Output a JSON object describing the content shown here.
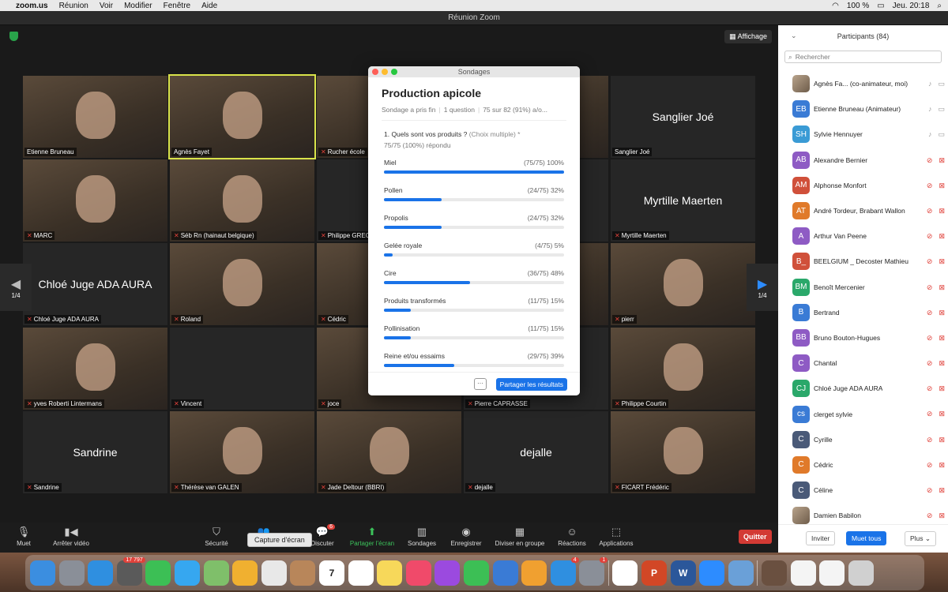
{
  "menubar": {
    "app": "zoom.us",
    "items": [
      "Réunion",
      "Voir",
      "Modifier",
      "Fenêtre",
      "Aide"
    ],
    "battery": "100 %",
    "clock": "Jeu. 20:18"
  },
  "window": {
    "title": "Réunion Zoom"
  },
  "main": {
    "view_button": "Affichage"
  },
  "tiles": [
    {
      "name": "Etienne Bruneau",
      "muted": false,
      "video": true
    },
    {
      "name": "Agnès Fayet",
      "muted": false,
      "video": true,
      "active": true
    },
    {
      "name": "Rucher école",
      "muted": true,
      "video": true
    },
    {
      "name": "",
      "muted": false,
      "video": true
    },
    {
      "name": "Sanglier Joé",
      "big": "Sanglier Joé",
      "muted": false,
      "video": false
    },
    {
      "name": "MARC",
      "muted": true,
      "video": true
    },
    {
      "name": "Séb Rn (hainaut belgique)",
      "muted": true,
      "video": true
    },
    {
      "name": "Philippe GREG",
      "big": "Philip",
      "muted": true,
      "video": false
    },
    {
      "name": "",
      "muted": false,
      "video": false
    },
    {
      "name": "Myrtille Maerten",
      "big": "Myrtille Maerten",
      "muted": true,
      "video": false
    },
    {
      "name": "Chloé Juge ADA AURA",
      "big": "Chloé Juge ADA AURA",
      "muted": true,
      "video": false
    },
    {
      "name": "Roland",
      "muted": true,
      "video": true
    },
    {
      "name": "Cédric",
      "muted": true,
      "video": true
    },
    {
      "name": "",
      "muted": false,
      "video": true
    },
    {
      "name": "pierr",
      "muted": true,
      "video": true
    },
    {
      "name": "yves Roberti Lintermans",
      "muted": true,
      "video": true
    },
    {
      "name": "Vincent",
      "muted": true,
      "video": false
    },
    {
      "name": "joce",
      "muted": true,
      "video": true
    },
    {
      "name": "Pierre CAPRASSE",
      "muted": true,
      "video": false
    },
    {
      "name": "Philippe Courtin",
      "muted": true,
      "video": true
    },
    {
      "name": "Sandrine",
      "big": "Sandrine",
      "muted": true,
      "video": false
    },
    {
      "name": "Thérèse van GALEN",
      "muted": true,
      "video": true
    },
    {
      "name": "Jade Deltour (BBRI)",
      "muted": true,
      "video": true
    },
    {
      "name": "dejalle",
      "big": "dejalle",
      "muted": true,
      "video": false
    },
    {
      "name": "FICART Frédéric",
      "muted": true,
      "video": true
    }
  ],
  "pager": {
    "left": "1/4",
    "right": "1/4"
  },
  "poll": {
    "window_title": "Sondages",
    "title": "Production apicole",
    "status": "Sondage a pris fin",
    "questions": "1 question",
    "participation": "75 sur 82 (91%) a/o...",
    "question": "1. Quels sont vos produits ?",
    "question_hint": "(Choix multiple) *",
    "answered": "75/75 (100%) répondu",
    "options": [
      {
        "label": "Miel",
        "count": "(75/75) 100%",
        "fraction": 1.0
      },
      {
        "label": "Pollen",
        "count": "(24/75) 32%",
        "fraction": 0.32
      },
      {
        "label": "Propolis",
        "count": "(24/75) 32%",
        "fraction": 0.32
      },
      {
        "label": "Gelée royale",
        "count": "(4/75) 5%",
        "fraction": 0.05
      },
      {
        "label": "Cire",
        "count": "(36/75) 48%",
        "fraction": 0.48
      },
      {
        "label": "Produits transformés",
        "count": "(11/75) 15%",
        "fraction": 0.15
      },
      {
        "label": "Pollinisation",
        "count": "(11/75) 15%",
        "fraction": 0.15
      },
      {
        "label": "Reine et/ou essaims",
        "count": "(29/75) 39%",
        "fraction": 0.39
      }
    ],
    "more": "···",
    "share_button": "Partager les résultats"
  },
  "participants": {
    "header": "Participants (84)",
    "search_placeholder": "Rechercher",
    "list": [
      {
        "initials": "",
        "name": "Agnès Fa... (co-animateur, moi)",
        "color": "#8a7a6a",
        "photo": true,
        "mic_off": false,
        "vid_off": false
      },
      {
        "initials": "EB",
        "name": "Etienne Bruneau (Animateur)",
        "color": "#3a7bd5",
        "mic_off": false,
        "vid_off": false
      },
      {
        "initials": "SH",
        "name": "Sylvie Hennuyer",
        "color": "#3a9bd5",
        "mic_off": false,
        "vid_off": false
      },
      {
        "initials": "AB",
        "name": "Alexandre Bernier",
        "color": "#8e5bc4",
        "mic_off": true,
        "vid_off": true
      },
      {
        "initials": "AM",
        "name": "Alphonse Monfort",
        "color": "#d0503a",
        "mic_off": true,
        "vid_off": true
      },
      {
        "initials": "AT",
        "name": "André Tordeur, Brabant Wallon",
        "color": "#e07a2a",
        "mic_off": true,
        "vid_off": true
      },
      {
        "initials": "A",
        "name": "Arthur Van Peene",
        "color": "#8e5bc4",
        "mic_off": true,
        "vid_off": true
      },
      {
        "initials": "B_",
        "name": "BEELGIUM _ Decoster Mathieu",
        "color": "#d0503a",
        "mic_off": true,
        "vid_off": true
      },
      {
        "initials": "BM",
        "name": "Benoît Mercenier",
        "color": "#2aa86a",
        "mic_off": true,
        "vid_off": true
      },
      {
        "initials": "B",
        "name": "Bertrand",
        "color": "#3a7bd5",
        "mic_off": true,
        "vid_off": true
      },
      {
        "initials": "BB",
        "name": "Bruno Bouton-Hugues",
        "color": "#8e5bc4",
        "mic_off": true,
        "vid_off": true
      },
      {
        "initials": "C",
        "name": "Chantal",
        "color": "#8e5bc4",
        "mic_off": true,
        "vid_off": true
      },
      {
        "initials": "CJ",
        "name": "Chloé Juge ADA AURA",
        "color": "#2aa86a",
        "mic_off": true,
        "vid_off": true
      },
      {
        "initials": "cs",
        "name": "clerget sylvie",
        "color": "#3a7bd5",
        "mic_off": true,
        "vid_off": true
      },
      {
        "initials": "C",
        "name": "Cyrille",
        "color": "#4a5a78",
        "mic_off": true,
        "vid_off": true
      },
      {
        "initials": "C",
        "name": "Cédric",
        "color": "#e07a2a",
        "mic_off": true,
        "vid_off": true
      },
      {
        "initials": "C",
        "name": "Céline",
        "color": "#4a5a78",
        "mic_off": true,
        "vid_off": true
      },
      {
        "initials": "",
        "name": "Damien Babilon",
        "color": "#6a5a4a",
        "photo": true,
        "mic_off": true,
        "vid_off": true
      }
    ],
    "invite_button": "Inviter",
    "mute_all_button": "Muet tous",
    "more_button": "Plus"
  },
  "toolbar": {
    "mute": "Muet",
    "stop_video": "Arrêter vidéo",
    "security": "Sécurité",
    "participants_count": "84",
    "chat": "Discuter",
    "chat_badge": "6",
    "share_screen": "Partager l'écran",
    "polls": "Sondages",
    "record": "Enregistrer",
    "breakout": "Diviser en groupe",
    "reactions": "Réactions",
    "apps": "Applications",
    "quit": "Quitter",
    "tooltip": "Capture d'écran"
  },
  "dock": {
    "icons": [
      {
        "name": "finder-icon",
        "color": "#3b8ee0"
      },
      {
        "name": "launchpad-icon",
        "color": "#8a8f98"
      },
      {
        "name": "safari-icon",
        "color": "#2f8fe0"
      },
      {
        "name": "photos-badge-icon",
        "color": "#5a5a5a",
        "badge": "17 797"
      },
      {
        "name": "facetime-icon",
        "color": "#3cbf55"
      },
      {
        "name": "messages-icon",
        "color": "#36a7f0"
      },
      {
        "name": "maps-icon",
        "color": "#7fbf6a"
      },
      {
        "name": "photos-icon",
        "color": "#f0b030"
      },
      {
        "name": "screenshot-icon",
        "color": "#e8e8e8"
      },
      {
        "name": "contacts-icon",
        "color": "#b8865a"
      },
      {
        "name": "calendar-icon",
        "color": "#ffffff",
        "text": "7"
      },
      {
        "name": "reminders-icon",
        "color": "#ffffff"
      },
      {
        "name": "notes-icon",
        "color": "#f7d85a"
      },
      {
        "name": "music-icon",
        "color": "#f04a6a"
      },
      {
        "name": "podcasts-icon",
        "color": "#9b4adf"
      },
      {
        "name": "numbers-icon",
        "color": "#3cbf55"
      },
      {
        "name": "keynote-icon",
        "color": "#3a7bd5"
      },
      {
        "name": "pages-icon",
        "color": "#f0a030"
      },
      {
        "name": "appstore-icon",
        "color": "#2f8fe0",
        "badge": "4"
      },
      {
        "name": "system-preferences-icon",
        "color": "#8a8f98",
        "badge": "1"
      },
      {
        "name": "chrome-icon",
        "color": "#ffffff"
      },
      {
        "name": "powerpoint-icon",
        "color": "#d24726",
        "text": "P"
      },
      {
        "name": "word-icon",
        "color": "#2b579a",
        "text": "W"
      },
      {
        "name": "zoom-icon",
        "color": "#2d8cff"
      },
      {
        "name": "preview-icon",
        "color": "#6aa0d8"
      },
      {
        "name": "downloads-folder-icon",
        "color": "#6a5040"
      },
      {
        "name": "document-icon",
        "color": "#f4f4f4"
      },
      {
        "name": "document2-icon",
        "color": "#f4f4f4"
      },
      {
        "name": "trash-icon",
        "color": "#d0d0d0"
      }
    ]
  }
}
